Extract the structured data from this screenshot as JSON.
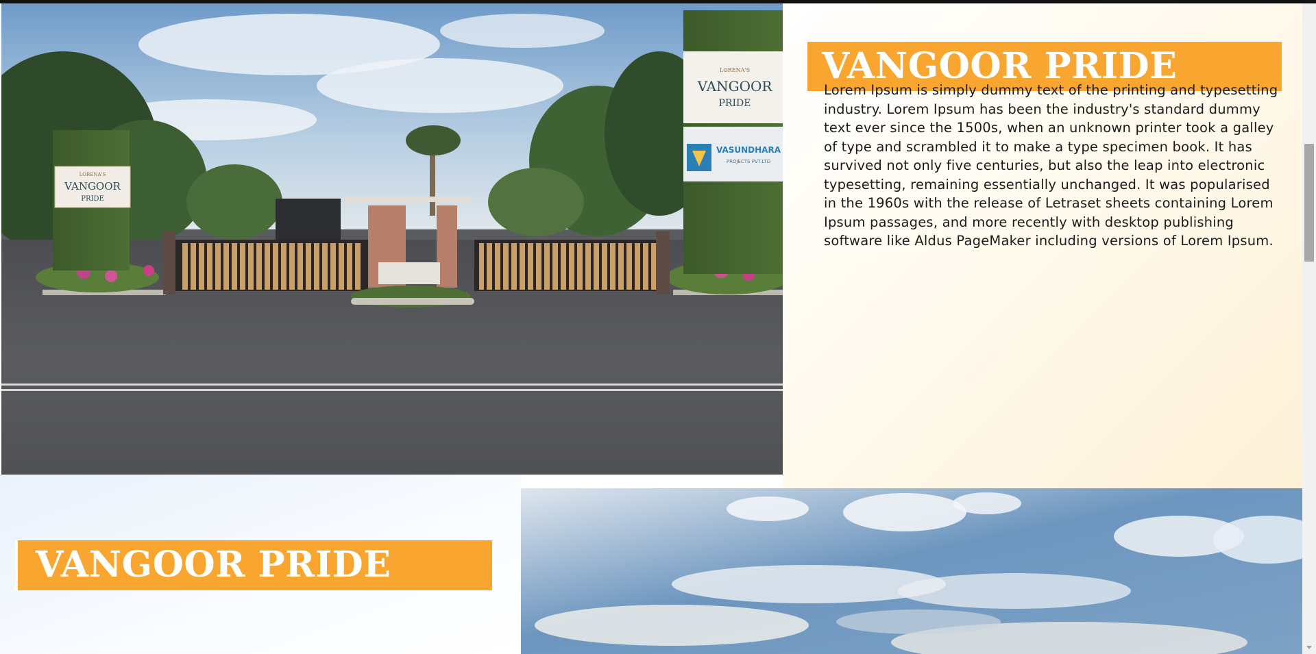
{
  "section1": {
    "image": {
      "alt": "Vangoor Pride entrance gate render",
      "left_sign": {
        "small": "LORENA'S",
        "name": "VANGOOR",
        "sub": "PRIDE"
      },
      "right_sign_top": {
        "small": "LORENA'S",
        "name": "VANGOOR",
        "sub": "PRIDE"
      },
      "right_sign_bottom": {
        "name": "VASUNDHARA",
        "sub": "PROJECTS PVT.LTD"
      }
    },
    "title": "VANGOOR PRIDE",
    "body": "Lorem Ipsum is simply dummy text of the printing and typesetting industry. Lorem Ipsum has been the industry's standard dummy text ever since the 1500s, when an unknown printer took a galley of type and scrambled it to make a type specimen book. It has survived not only five centuries, but also the leap into electronic typesetting, remaining essentially unchanged. It was popularised in the 1960s with the release of Letraset sheets containing Lorem Ipsum passages, and more recently with desktop publishing software like Aldus PageMaker including versions of Lorem Ipsum."
  },
  "section2": {
    "title": "VANGOOR PRIDE",
    "image": {
      "alt": "Sky view"
    }
  },
  "colors": {
    "accent": "#f9a630",
    "title_text": "#ffffff",
    "body_text": "#1b1b1b"
  },
  "scrollbar": {
    "arrow": "down-arrow-icon"
  }
}
